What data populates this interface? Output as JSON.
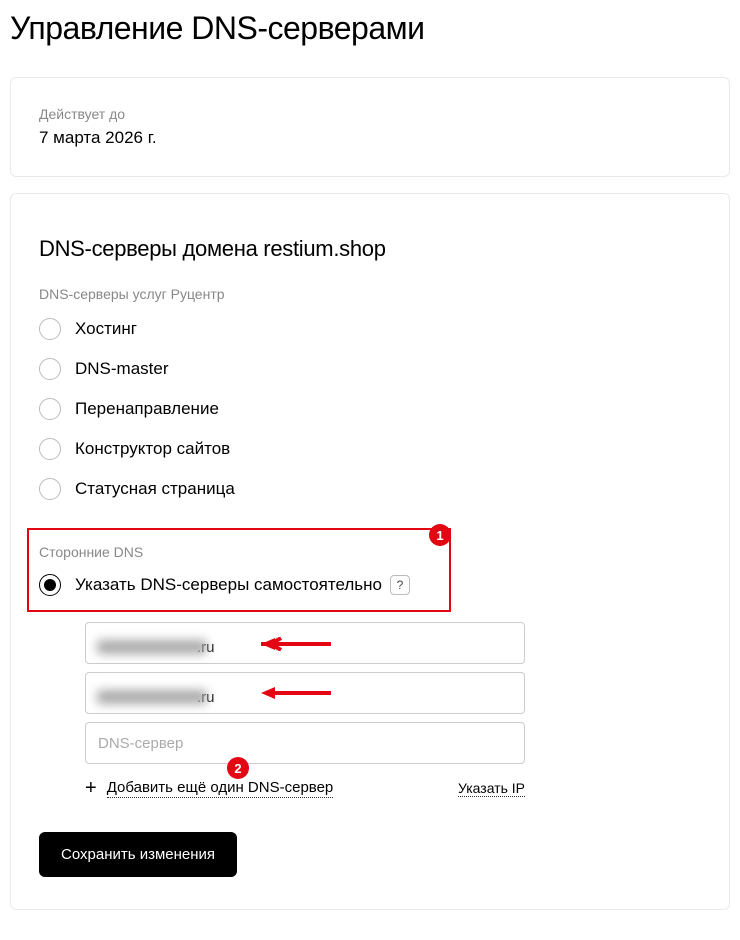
{
  "page_title": "Управление DNS-серверами",
  "expiry": {
    "label": "Действует до",
    "date": "7 марта 2026 г."
  },
  "dns_section": {
    "title": "DNS-серверы домена restium.shop",
    "rucenter_group_label": "DNS-серверы услуг Руцентр",
    "options": [
      {
        "label": "Хостинг"
      },
      {
        "label": "DNS-master"
      },
      {
        "label": "Перенаправление"
      },
      {
        "label": "Конструктор сайтов"
      },
      {
        "label": "Статусная страница"
      }
    ],
    "custom_group_label": "Сторонние DNS",
    "custom_option_label": "Указать DNS-серверы самостоятельно",
    "help": "?",
    "inputs": {
      "server1_suffix": ".ru",
      "server2_suffix": ".ru",
      "server3_placeholder": "DNS-сервер"
    },
    "add_link": "Добавить ещё один DNS-сервер",
    "ip_link": "Указать IP",
    "save_button": "Сохранить изменения"
  },
  "annotations": {
    "badge1": "1",
    "badge2": "2"
  }
}
